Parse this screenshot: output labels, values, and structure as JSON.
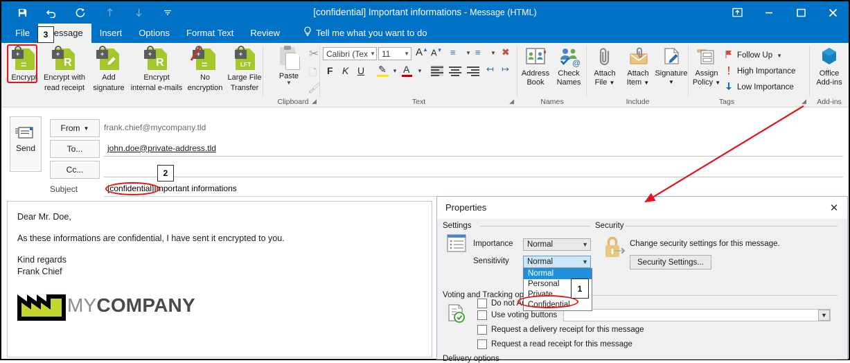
{
  "window": {
    "title_main": "[confidential] Important informations -",
    "title_sub": "Message (HTML)",
    "quick_access": [
      {
        "name": "save-icon",
        "glyph": "💾"
      },
      {
        "name": "undo-icon",
        "glyph": "↶"
      },
      {
        "name": "redo-icon",
        "glyph": "↻"
      },
      {
        "name": "move-up-icon",
        "glyph": "↑"
      },
      {
        "name": "move-down-icon",
        "glyph": "↓"
      },
      {
        "name": "customize-qat-icon",
        "glyph": "☰"
      }
    ],
    "controls": {
      "ribbon_options": "ribbon-display-options",
      "minimize": "minimize",
      "maximize": "maximize",
      "close": "close"
    }
  },
  "tabs": [
    {
      "label": "File",
      "active": false
    },
    {
      "label": "Message",
      "active": true
    },
    {
      "label": "Insert",
      "active": false
    },
    {
      "label": "Options",
      "active": false
    },
    {
      "label": "Format Text",
      "active": false
    },
    {
      "label": "Review",
      "active": false
    }
  ],
  "tell_me": "Tell me what you want to do",
  "ribbon": {
    "encryption": {
      "group_label": "",
      "buttons": [
        {
          "label_1": "Encrypt",
          "label_2": "",
          "icon": "encrypt-icon",
          "highlighted": true
        },
        {
          "label_1": "Encrypt with",
          "label_2": "read receipt",
          "icon": "encrypt-read-receipt-icon",
          "highlighted": false
        },
        {
          "label_1": "Add",
          "label_2": "signature",
          "icon": "add-signature-icon",
          "highlighted": false
        },
        {
          "label_1": "Encrypt",
          "label_2": "internal e-mails",
          "icon": "encrypt-internal-icon",
          "highlighted": false
        },
        {
          "label_1": "No",
          "label_2": "encryption",
          "icon": "no-encryption-icon",
          "highlighted": false
        },
        {
          "label_1": "Large File",
          "label_2": "Transfer",
          "icon": "large-file-transfer-icon",
          "highlighted": false
        }
      ]
    },
    "clipboard": {
      "group_label": "Clipboard",
      "paste_label": "Paste"
    },
    "text": {
      "group_label": "Text",
      "font_name": "Calibri (Tex",
      "font_size": "11",
      "bold": "F",
      "italic": "K",
      "underline": "U"
    },
    "names": {
      "group_label": "Names",
      "buttons": [
        {
          "label_1": "Address",
          "label_2": "Book",
          "icon": "address-book-icon"
        },
        {
          "label_1": "Check",
          "label_2": "Names",
          "icon": "check-names-icon"
        }
      ]
    },
    "include": {
      "group_label": "Include",
      "buttons": [
        {
          "label_1": "Attach",
          "label_2": "File",
          "icon": "attach-file-icon"
        },
        {
          "label_1": "Attach",
          "label_2": "Item",
          "icon": "attach-item-icon"
        },
        {
          "label_1": "Signature",
          "label_2": "",
          "icon": "signature-icon"
        }
      ]
    },
    "tags": {
      "group_label": "Tags",
      "assign_policy_1": "Assign",
      "assign_policy_2": "Policy",
      "items": [
        {
          "label": "Follow Up",
          "icon": "flag-icon",
          "has_caret": true
        },
        {
          "label": "High Importance",
          "icon": "exclamation-icon",
          "has_caret": false
        },
        {
          "label": "Low Importance",
          "icon": "down-arrow-icon",
          "has_caret": false
        }
      ]
    },
    "addins": {
      "group_label": "Add-ins",
      "label_1": "Office",
      "label_2": "Add-ins",
      "icon": "office-addins-icon"
    }
  },
  "header": {
    "send_label": "Send",
    "from_label": "From",
    "from_value": "frank.chief@mycompany.tld",
    "to_label": "To...",
    "to_value": "john.doe@private-address.tld",
    "cc_label": "Cc...",
    "cc_value": "",
    "subject_label": "Subject",
    "subject_prefix": "[confidential]",
    "subject_rest": "Important informations"
  },
  "body": {
    "paragraphs": [
      "Dear Mr. Doe,",
      "As these informations are confidential, I have sent it encrypted to you.",
      "Kind regards"
    ],
    "signature_name": "Frank Chief",
    "logo_text_a": "MY",
    "logo_text_b": "COMPANY",
    "logo_color": "#c3d62e"
  },
  "properties_dialog": {
    "title": "Properties",
    "close_label": "✕",
    "settings": {
      "group_label": "Settings",
      "importance_label": "Importance",
      "importance_value": "Normal",
      "sensitivity_label": "Sensitivity",
      "sensitivity_value": "Normal",
      "sensitivity_options": [
        {
          "label": "Normal",
          "selected": true
        },
        {
          "label": "Personal",
          "selected": false
        },
        {
          "label": "Private",
          "selected": false
        },
        {
          "label": "Confidential",
          "selected": false
        }
      ],
      "do_not_autoarchive": "Do not AutoArchive this item"
    },
    "security": {
      "group_label": "Security",
      "description": "Change security settings for this message.",
      "button_label": "Security Settings..."
    },
    "voting": {
      "group_label": "Voting and Tracking options",
      "use_voting_buttons": "Use voting buttons",
      "delivery_receipt": "Request a delivery receipt for this message",
      "read_receipt": "Request a read receipt for this message",
      "voting_value": ""
    },
    "delivery": {
      "group_label": "Delivery options"
    }
  },
  "annotations": {
    "accent_color": "#e8131a",
    "markers": [
      {
        "id": "1",
        "target": "confidential-option"
      },
      {
        "id": "2",
        "target": "subject-prefix"
      },
      {
        "id": "3",
        "target": "encrypt-button"
      }
    ]
  }
}
